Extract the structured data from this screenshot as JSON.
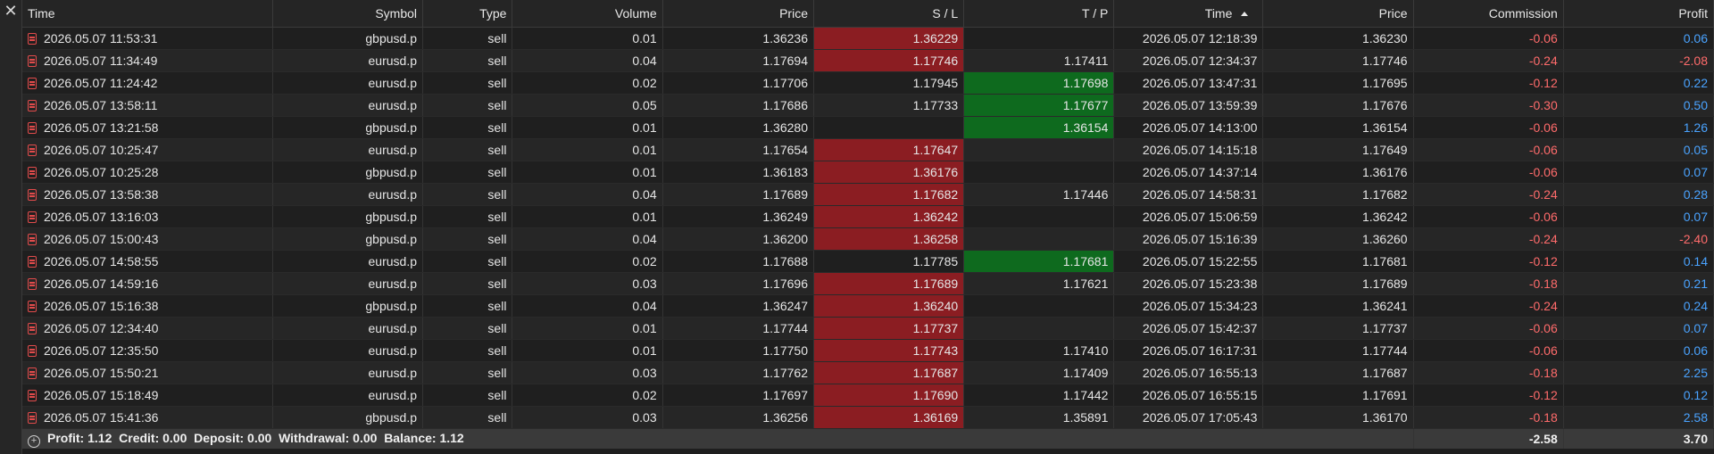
{
  "headers": {
    "time": "Time",
    "symbol": "Symbol",
    "type": "Type",
    "volume": "Volume",
    "price": "Price",
    "sl": "S / L",
    "tp": "T / P",
    "close_time": "Time",
    "close_price": "Price",
    "commission": "Commission",
    "profit": "Profit"
  },
  "icons": {
    "close": "close-icon",
    "row": "document-icon",
    "sort": "sort-ascending-icon",
    "expand": "plus-circle-icon"
  },
  "colors": {
    "sl_highlight": "#8b1d22",
    "tp_highlight": "#0e6a1e",
    "negative": "#ff6b6b",
    "positive": "#4aa3ff"
  },
  "rows": [
    {
      "time": "2026.05.07 11:53:31",
      "symbol": "gbpusd.p",
      "type": "sell",
      "volume": "0.01",
      "price": "1.36236",
      "sl": "1.36229",
      "tp": "",
      "close_time": "2026.05.07 12:18:39",
      "close_price": "1.36230",
      "commission": "-0.06",
      "profit": "0.06",
      "sl_hl": true,
      "tp_hl": false
    },
    {
      "time": "2026.05.07 11:34:49",
      "symbol": "eurusd.p",
      "type": "sell",
      "volume": "0.04",
      "price": "1.17694",
      "sl": "1.17746",
      "tp": "1.17411",
      "close_time": "2026.05.07 12:34:37",
      "close_price": "1.17746",
      "commission": "-0.24",
      "profit": "-2.08",
      "sl_hl": true,
      "tp_hl": false
    },
    {
      "time": "2026.05.07 11:24:42",
      "symbol": "eurusd.p",
      "type": "sell",
      "volume": "0.02",
      "price": "1.17706",
      "sl": "1.17945",
      "tp": "1.17698",
      "close_time": "2026.05.07 13:47:31",
      "close_price": "1.17695",
      "commission": "-0.12",
      "profit": "0.22",
      "sl_hl": false,
      "tp_hl": true
    },
    {
      "time": "2026.05.07 13:58:11",
      "symbol": "eurusd.p",
      "type": "sell",
      "volume": "0.05",
      "price": "1.17686",
      "sl": "1.17733",
      "tp": "1.17677",
      "close_time": "2026.05.07 13:59:39",
      "close_price": "1.17676",
      "commission": "-0.30",
      "profit": "0.50",
      "sl_hl": false,
      "tp_hl": true
    },
    {
      "time": "2026.05.07 13:21:58",
      "symbol": "gbpusd.p",
      "type": "sell",
      "volume": "0.01",
      "price": "1.36280",
      "sl": "",
      "tp": "1.36154",
      "close_time": "2026.05.07 14:13:00",
      "close_price": "1.36154",
      "commission": "-0.06",
      "profit": "1.26",
      "sl_hl": false,
      "tp_hl": true
    },
    {
      "time": "2026.05.07 10:25:47",
      "symbol": "eurusd.p",
      "type": "sell",
      "volume": "0.01",
      "price": "1.17654",
      "sl": "1.17647",
      "tp": "",
      "close_time": "2026.05.07 14:15:18",
      "close_price": "1.17649",
      "commission": "-0.06",
      "profit": "0.05",
      "sl_hl": true,
      "tp_hl": false
    },
    {
      "time": "2026.05.07 10:25:28",
      "symbol": "gbpusd.p",
      "type": "sell",
      "volume": "0.01",
      "price": "1.36183",
      "sl": "1.36176",
      "tp": "",
      "close_time": "2026.05.07 14:37:14",
      "close_price": "1.36176",
      "commission": "-0.06",
      "profit": "0.07",
      "sl_hl": true,
      "tp_hl": false
    },
    {
      "time": "2026.05.07 13:58:38",
      "symbol": "eurusd.p",
      "type": "sell",
      "volume": "0.04",
      "price": "1.17689",
      "sl": "1.17682",
      "tp": "1.17446",
      "close_time": "2026.05.07 14:58:31",
      "close_price": "1.17682",
      "commission": "-0.24",
      "profit": "0.28",
      "sl_hl": true,
      "tp_hl": false
    },
    {
      "time": "2026.05.07 13:16:03",
      "symbol": "gbpusd.p",
      "type": "sell",
      "volume": "0.01",
      "price": "1.36249",
      "sl": "1.36242",
      "tp": "",
      "close_time": "2026.05.07 15:06:59",
      "close_price": "1.36242",
      "commission": "-0.06",
      "profit": "0.07",
      "sl_hl": true,
      "tp_hl": false
    },
    {
      "time": "2026.05.07 15:00:43",
      "symbol": "gbpusd.p",
      "type": "sell",
      "volume": "0.04",
      "price": "1.36200",
      "sl": "1.36258",
      "tp": "",
      "close_time": "2026.05.07 15:16:39",
      "close_price": "1.36260",
      "commission": "-0.24",
      "profit": "-2.40",
      "sl_hl": true,
      "tp_hl": false
    },
    {
      "time": "2026.05.07 14:58:55",
      "symbol": "eurusd.p",
      "type": "sell",
      "volume": "0.02",
      "price": "1.17688",
      "sl": "1.17785",
      "tp": "1.17681",
      "close_time": "2026.05.07 15:22:55",
      "close_price": "1.17681",
      "commission": "-0.12",
      "profit": "0.14",
      "sl_hl": false,
      "tp_hl": true
    },
    {
      "time": "2026.05.07 14:59:16",
      "symbol": "eurusd.p",
      "type": "sell",
      "volume": "0.03",
      "price": "1.17696",
      "sl": "1.17689",
      "tp": "1.17621",
      "close_time": "2026.05.07 15:23:38",
      "close_price": "1.17689",
      "commission": "-0.18",
      "profit": "0.21",
      "sl_hl": true,
      "tp_hl": false
    },
    {
      "time": "2026.05.07 15:16:38",
      "symbol": "gbpusd.p",
      "type": "sell",
      "volume": "0.04",
      "price": "1.36247",
      "sl": "1.36240",
      "tp": "",
      "close_time": "2026.05.07 15:34:23",
      "close_price": "1.36241",
      "commission": "-0.24",
      "profit": "0.24",
      "sl_hl": true,
      "tp_hl": false
    },
    {
      "time": "2026.05.07 12:34:40",
      "symbol": "eurusd.p",
      "type": "sell",
      "volume": "0.01",
      "price": "1.17744",
      "sl": "1.17737",
      "tp": "",
      "close_time": "2026.05.07 15:42:37",
      "close_price": "1.17737",
      "commission": "-0.06",
      "profit": "0.07",
      "sl_hl": true,
      "tp_hl": false
    },
    {
      "time": "2026.05.07 12:35:50",
      "symbol": "eurusd.p",
      "type": "sell",
      "volume": "0.01",
      "price": "1.17750",
      "sl": "1.17743",
      "tp": "1.17410",
      "close_time": "2026.05.07 16:17:31",
      "close_price": "1.17744",
      "commission": "-0.06",
      "profit": "0.06",
      "sl_hl": true,
      "tp_hl": false
    },
    {
      "time": "2026.05.07 15:50:21",
      "symbol": "eurusd.p",
      "type": "sell",
      "volume": "0.03",
      "price": "1.17762",
      "sl": "1.17687",
      "tp": "1.17409",
      "close_time": "2026.05.07 16:55:13",
      "close_price": "1.17687",
      "commission": "-0.18",
      "profit": "2.25",
      "sl_hl": true,
      "tp_hl": false
    },
    {
      "time": "2026.05.07 15:18:49",
      "symbol": "eurusd.p",
      "type": "sell",
      "volume": "0.02",
      "price": "1.17697",
      "sl": "1.17690",
      "tp": "1.17442",
      "close_time": "2026.05.07 16:55:15",
      "close_price": "1.17691",
      "commission": "-0.12",
      "profit": "0.12",
      "sl_hl": true,
      "tp_hl": false
    },
    {
      "time": "2026.05.07 15:41:36",
      "symbol": "gbpusd.p",
      "type": "sell",
      "volume": "0.03",
      "price": "1.36256",
      "sl": "1.36169",
      "tp": "1.35891",
      "close_time": "2026.05.07 17:05:43",
      "close_price": "1.36170",
      "commission": "-0.18",
      "profit": "2.58",
      "sl_hl": true,
      "tp_hl": false
    }
  ],
  "summary": {
    "text": "Profit: 1.12  Credit: 0.00  Deposit: 0.00  Withdrawal: 0.00  Balance: 1.12",
    "commission_total": "-2.58",
    "profit_total": "3.70"
  }
}
